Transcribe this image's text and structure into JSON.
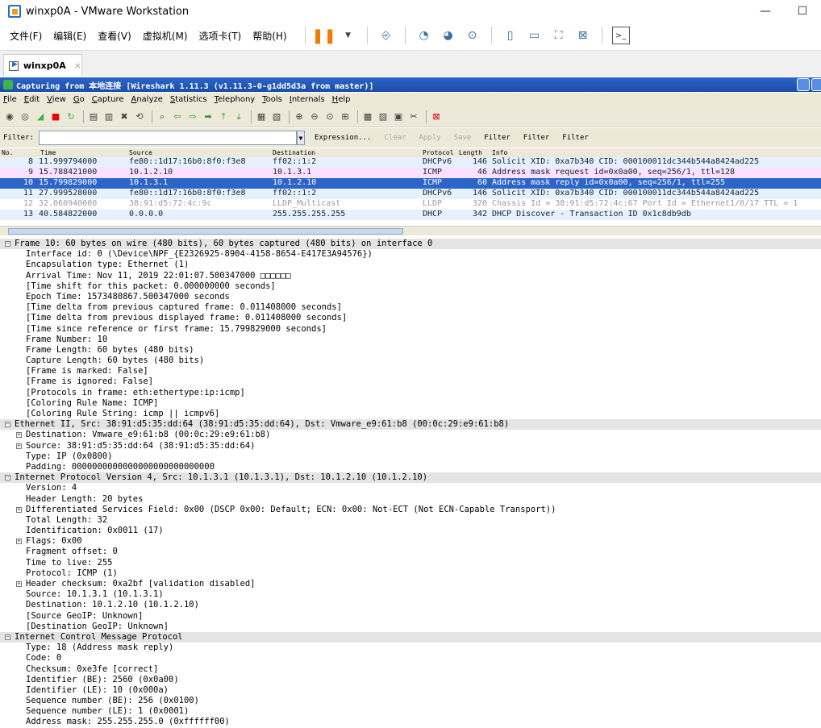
{
  "vm": {
    "title": "winxp0A - VMware Workstation",
    "menu": [
      "文件(F)",
      "编辑(E)",
      "查看(V)",
      "虚拟机(M)",
      "选项卡(T)",
      "帮助(H)"
    ],
    "tab_label": "winxp0A",
    "tab_close": "×",
    "win_controls": [
      "—",
      "☐"
    ]
  },
  "ws": {
    "title": "Capturing from 本地连接    [Wireshark 1.11.3  (v1.11.3-0-g1dd5d3a from master)]",
    "menu": [
      "File",
      "Edit",
      "View",
      "Go",
      "Capture",
      "Analyze",
      "Statistics",
      "Telephony",
      "Tools",
      "Internals",
      "Help"
    ],
    "filter_label": "Filter:",
    "filter_buttons": [
      "Expression...",
      "Clear",
      "Apply",
      "Save",
      "Filter",
      "Filter",
      "Filter"
    ],
    "columns": [
      "No.",
      "Time",
      "Source",
      "Destination",
      "Protocol",
      "Length",
      "Info"
    ],
    "packets": [
      {
        "no": "8",
        "time": "11.999794000",
        "src": "fe80::1d17:16b0:8f0:f3e8",
        "dst": "ff02::1:2",
        "proto": "DHCPv6",
        "len": "146",
        "info": "Solicit XID: 0xa7b340 CID: 000100011dc344b544a8424ad225",
        "bg": "#e6f0ff",
        "fg": "#12272e"
      },
      {
        "no": "9",
        "time": "15.788421000",
        "src": "10.1.2.10",
        "dst": "10.1.3.1",
        "proto": "ICMP",
        "len": "46",
        "info": "Address mask request id=0x0a00, seq=256/1, ttl=128",
        "bg": "#fce0ff",
        "fg": "#12272e"
      },
      {
        "no": "10",
        "time": "15.799829000",
        "src": "10.1.3.1",
        "dst": "10.1.2.10",
        "proto": "ICMP",
        "len": "60",
        "info": "Address mask reply   id=0x0a00, seq=256/1, ttl=255",
        "bg": "#2c65c8",
        "fg": "#ffffff"
      },
      {
        "no": "11",
        "time": "27.999528000",
        "src": "fe80::1d17:16b0:8f0:f3e8",
        "dst": "ff02::1:2",
        "proto": "DHCPv6",
        "len": "146",
        "info": "Solicit XID: 0xa7b340 CID: 000100011dc344b544a8424ad225",
        "bg": "#e6f0ff",
        "fg": "#12272e"
      },
      {
        "no": "12",
        "time": "32.060940000",
        "src": "38:91:d5:72:4c:9c",
        "dst": "LLDP_Multicast",
        "proto": "LLDP",
        "len": "320",
        "info": "Chassis Id = 38:91:d5:72:4c:67 Port Id = Ethernet1/0/17 TTL = 1",
        "bg": "#ffffff",
        "fg": "#9a9a9a"
      },
      {
        "no": "13",
        "time": "40.584822000",
        "src": "0.0.0.0",
        "dst": "255.255.255.255",
        "proto": "DHCP",
        "len": "342",
        "info": "DHCP Discover - Transaction ID 0x1c8db9db",
        "bg": "#e6f0ff",
        "fg": "#12272e"
      }
    ],
    "details": [
      {
        "level": 0,
        "exp": "⊟",
        "text": "Frame 10: 60 bytes on wire (480 bits), 60 bytes captured (480 bits) on interface 0"
      },
      {
        "level": 1,
        "exp": "",
        "text": "Interface id: 0 (\\Device\\NPF_{E2326925-8904-4158-8654-E417E3A94576})"
      },
      {
        "level": 1,
        "exp": "",
        "text": "Encapsulation type: Ethernet (1)"
      },
      {
        "level": 1,
        "exp": "",
        "text": "Arrival Time: Nov 11, 2019 22:01:07.500347000 □□□□□□"
      },
      {
        "level": 1,
        "exp": "",
        "text": "[Time shift for this packet: 0.000000000 seconds]"
      },
      {
        "level": 1,
        "exp": "",
        "text": "Epoch Time: 1573480867.500347000 seconds"
      },
      {
        "level": 1,
        "exp": "",
        "text": "[Time delta from previous captured frame: 0.011408000 seconds]"
      },
      {
        "level": 1,
        "exp": "",
        "text": "[Time delta from previous displayed frame: 0.011408000 seconds]"
      },
      {
        "level": 1,
        "exp": "",
        "text": "[Time since reference or first frame: 15.799829000 seconds]"
      },
      {
        "level": 1,
        "exp": "",
        "text": "Frame Number: 10"
      },
      {
        "level": 1,
        "exp": "",
        "text": "Frame Length: 60 bytes (480 bits)"
      },
      {
        "level": 1,
        "exp": "",
        "text": "Capture Length: 60 bytes (480 bits)"
      },
      {
        "level": 1,
        "exp": "",
        "text": "[Frame is marked: False]"
      },
      {
        "level": 1,
        "exp": "",
        "text": "[Frame is ignored: False]"
      },
      {
        "level": 1,
        "exp": "",
        "text": "[Protocols in frame: eth:ethertype:ip:icmp]"
      },
      {
        "level": 1,
        "exp": "",
        "text": "[Coloring Rule Name: ICMP]"
      },
      {
        "level": 1,
        "exp": "",
        "text": "[Coloring Rule String: icmp || icmpv6]"
      },
      {
        "level": 0,
        "exp": "⊟",
        "text": "Ethernet II, Src: 38:91:d5:35:dd:64 (38:91:d5:35:dd:64), Dst: Vmware_e9:61:b8 (00:0c:29:e9:61:b8)"
      },
      {
        "level": 1,
        "exp": "⊞",
        "text": "Destination: Vmware_e9:61:b8 (00:0c:29:e9:61:b8)"
      },
      {
        "level": 1,
        "exp": "⊞",
        "text": "Source: 38:91:d5:35:dd:64 (38:91:d5:35:dd:64)"
      },
      {
        "level": 1,
        "exp": "",
        "text": "Type: IP (0x0800)"
      },
      {
        "level": 1,
        "exp": "",
        "text": "Padding: 0000000000000000000000000000"
      },
      {
        "level": 0,
        "exp": "⊟",
        "text": "Internet Protocol Version 4, Src: 10.1.3.1 (10.1.3.1), Dst: 10.1.2.10 (10.1.2.10)"
      },
      {
        "level": 1,
        "exp": "",
        "text": "Version: 4"
      },
      {
        "level": 1,
        "exp": "",
        "text": "Header Length: 20 bytes"
      },
      {
        "level": 1,
        "exp": "⊞",
        "text": "Differentiated Services Field: 0x00 (DSCP 0x00: Default; ECN: 0x00: Not-ECT (Not ECN-Capable Transport))"
      },
      {
        "level": 1,
        "exp": "",
        "text": "Total Length: 32"
      },
      {
        "level": 1,
        "exp": "",
        "text": "Identification: 0x0011 (17)"
      },
      {
        "level": 1,
        "exp": "⊞",
        "text": "Flags: 0x00"
      },
      {
        "level": 1,
        "exp": "",
        "text": "Fragment offset: 0"
      },
      {
        "level": 1,
        "exp": "",
        "text": "Time to live: 255"
      },
      {
        "level": 1,
        "exp": "",
        "text": "Protocol: ICMP (1)"
      },
      {
        "level": 1,
        "exp": "⊞",
        "text": "Header checksum: 0xa2bf [validation disabled]"
      },
      {
        "level": 1,
        "exp": "",
        "text": "Source: 10.1.3.1 (10.1.3.1)"
      },
      {
        "level": 1,
        "exp": "",
        "text": "Destination: 10.1.2.10 (10.1.2.10)"
      },
      {
        "level": 1,
        "exp": "",
        "text": "[Source GeoIP: Unknown]"
      },
      {
        "level": 1,
        "exp": "",
        "text": "[Destination GeoIP: Unknown]"
      },
      {
        "level": 0,
        "exp": "⊟",
        "text": "Internet Control Message Protocol"
      },
      {
        "level": 1,
        "exp": "",
        "text": "Type: 18 (Address mask reply)"
      },
      {
        "level": 1,
        "exp": "",
        "text": "Code: 0"
      },
      {
        "level": 1,
        "exp": "",
        "text": "Checksum: 0xe3fe [correct]"
      },
      {
        "level": 1,
        "exp": "",
        "text": "Identifier (BE): 2560 (0x0a00)"
      },
      {
        "level": 1,
        "exp": "",
        "text": "Identifier (LE): 10 (0x000a)"
      },
      {
        "level": 1,
        "exp": "",
        "text": "Sequence number (BE): 256 (0x0100)"
      },
      {
        "level": 1,
        "exp": "",
        "text": "Sequence number (LE): 1 (0x0001)"
      },
      {
        "level": 1,
        "exp": "",
        "text": "Address mask: 255.255.255.0 (0xffffff00)"
      }
    ]
  }
}
